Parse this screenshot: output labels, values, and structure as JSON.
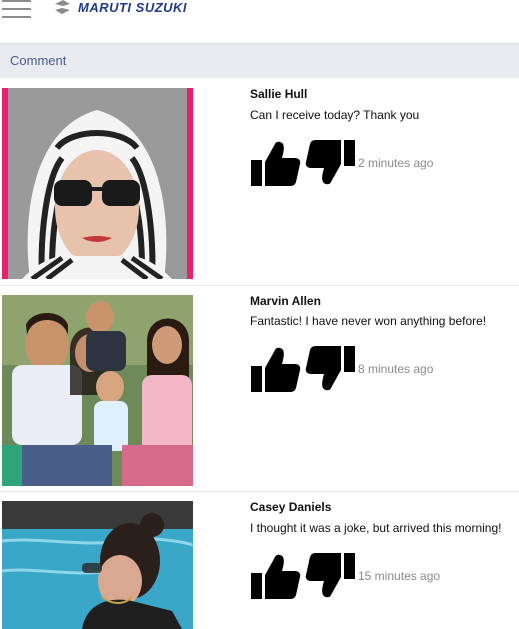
{
  "header": {
    "brand_name": "MARUTI SUZUKI",
    "menu_icon": "hamburger-menu-icon",
    "brand_color": "#1f3a8a"
  },
  "section": {
    "title": "Comment"
  },
  "comments": [
    {
      "author": "Sallie Hull",
      "text": "Can I receive today? Thank you",
      "time": "2 minutes ago",
      "photo": "woman in striped headscarf and sunglasses",
      "like_icon": "thumbs-up-icon",
      "dislike_icon": "thumbs-down-icon"
    },
    {
      "author": "Marvin Allen",
      "text": "Fantastic! I have never won anything before!",
      "time": "8 minutes ago",
      "photo": "family group photo",
      "like_icon": "thumbs-up-icon",
      "dislike_icon": "thumbs-down-icon"
    },
    {
      "author": "Casey Daniels",
      "text": "I thought it was a joke, but arrived this morning!",
      "time": "15 minutes ago",
      "photo": "woman at swimming pool",
      "like_icon": "thumbs-up-icon",
      "dislike_icon": "thumbs-down-icon"
    }
  ],
  "colors": {
    "comment_bar_bg": "#eaeaf1",
    "comment_bar_text": "#4a5a8a",
    "timestamp": "#8a8a8a",
    "photo_border_accent": "#e8206f"
  }
}
